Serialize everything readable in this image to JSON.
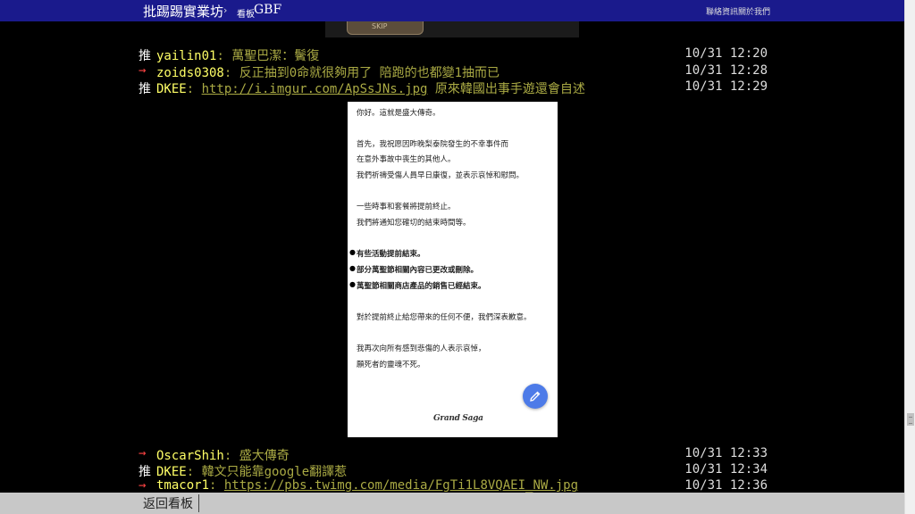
{
  "header": {
    "board_link": "批踢踢實業坊",
    "breadcrumb_sep": "›",
    "board_label": "看板",
    "board_name": "GBF",
    "contact": "聯絡資訊",
    "about": "關於我們"
  },
  "top_image": {
    "caption": "SKIP"
  },
  "pushes_top": [
    {
      "tag": "推",
      "userid": "yailin01",
      "content": ": 萬聖巴潔：鬢復",
      "time": "10/31 12:20",
      "type": "up"
    },
    {
      "tag": "→",
      "userid": "zoids0308",
      "content": ": 反正抽到0命就很夠用了 陪跑的也都變1抽而已",
      "time": "10/31 12:28",
      "type": "arrow"
    },
    {
      "tag": "推",
      "userid": "DKEE",
      "sep": ": ",
      "link": "http://i.imgur.com/ApSsJNs.jpg",
      "content": " 原來韓國出事手遊還會自述",
      "time": "10/31 12:29",
      "type": "up"
    }
  ],
  "announcement": {
    "line1": "你好。這就是盛大傳奇。",
    "line2": "首先，我祝愿因昨晚梨泰院發生的不幸事件而",
    "line3": "在意外事故中喪生的其他人。",
    "line4": "我們祈禱受傷人員早日康復，並表示哀悼和慰問。",
    "line5": "一些時事和套餐將提前終止。",
    "line6": "我們將通知您確切的結束時間等。",
    "bullet1": "有些活動提前結束。",
    "bullet2": "部分萬聖節相關內容已更改或刪除。",
    "bullet3": "萬聖節相關商店產品的銷售已經結束。",
    "line7": "對於提前終止給您帶來的任何不便，我們深表歉意。",
    "line8": "我再次向所有感到悲傷的人表示哀悼，",
    "line9": "願死者的靈魂不死。",
    "logo": "Grand Saga"
  },
  "pushes_bottom": [
    {
      "tag": "→",
      "userid": "OscarShih",
      "content": ": 盛大傳奇",
      "time": "10/31 12:33",
      "type": "arrow"
    },
    {
      "tag": "推",
      "userid": "DKEE",
      "content": ": 韓文只能靠google翻譯惹",
      "time": "10/31 12:34",
      "type": "up"
    },
    {
      "tag": "→",
      "userid": "tmacor1",
      "sep": ": ",
      "link": "https://pbs.twimg.com/media/FgTi1L8VQAEI_NW.jpg",
      "content": "",
      "time": "10/31 12:36",
      "type": "arrow"
    }
  ],
  "footer": {
    "back": "返回看板"
  }
}
